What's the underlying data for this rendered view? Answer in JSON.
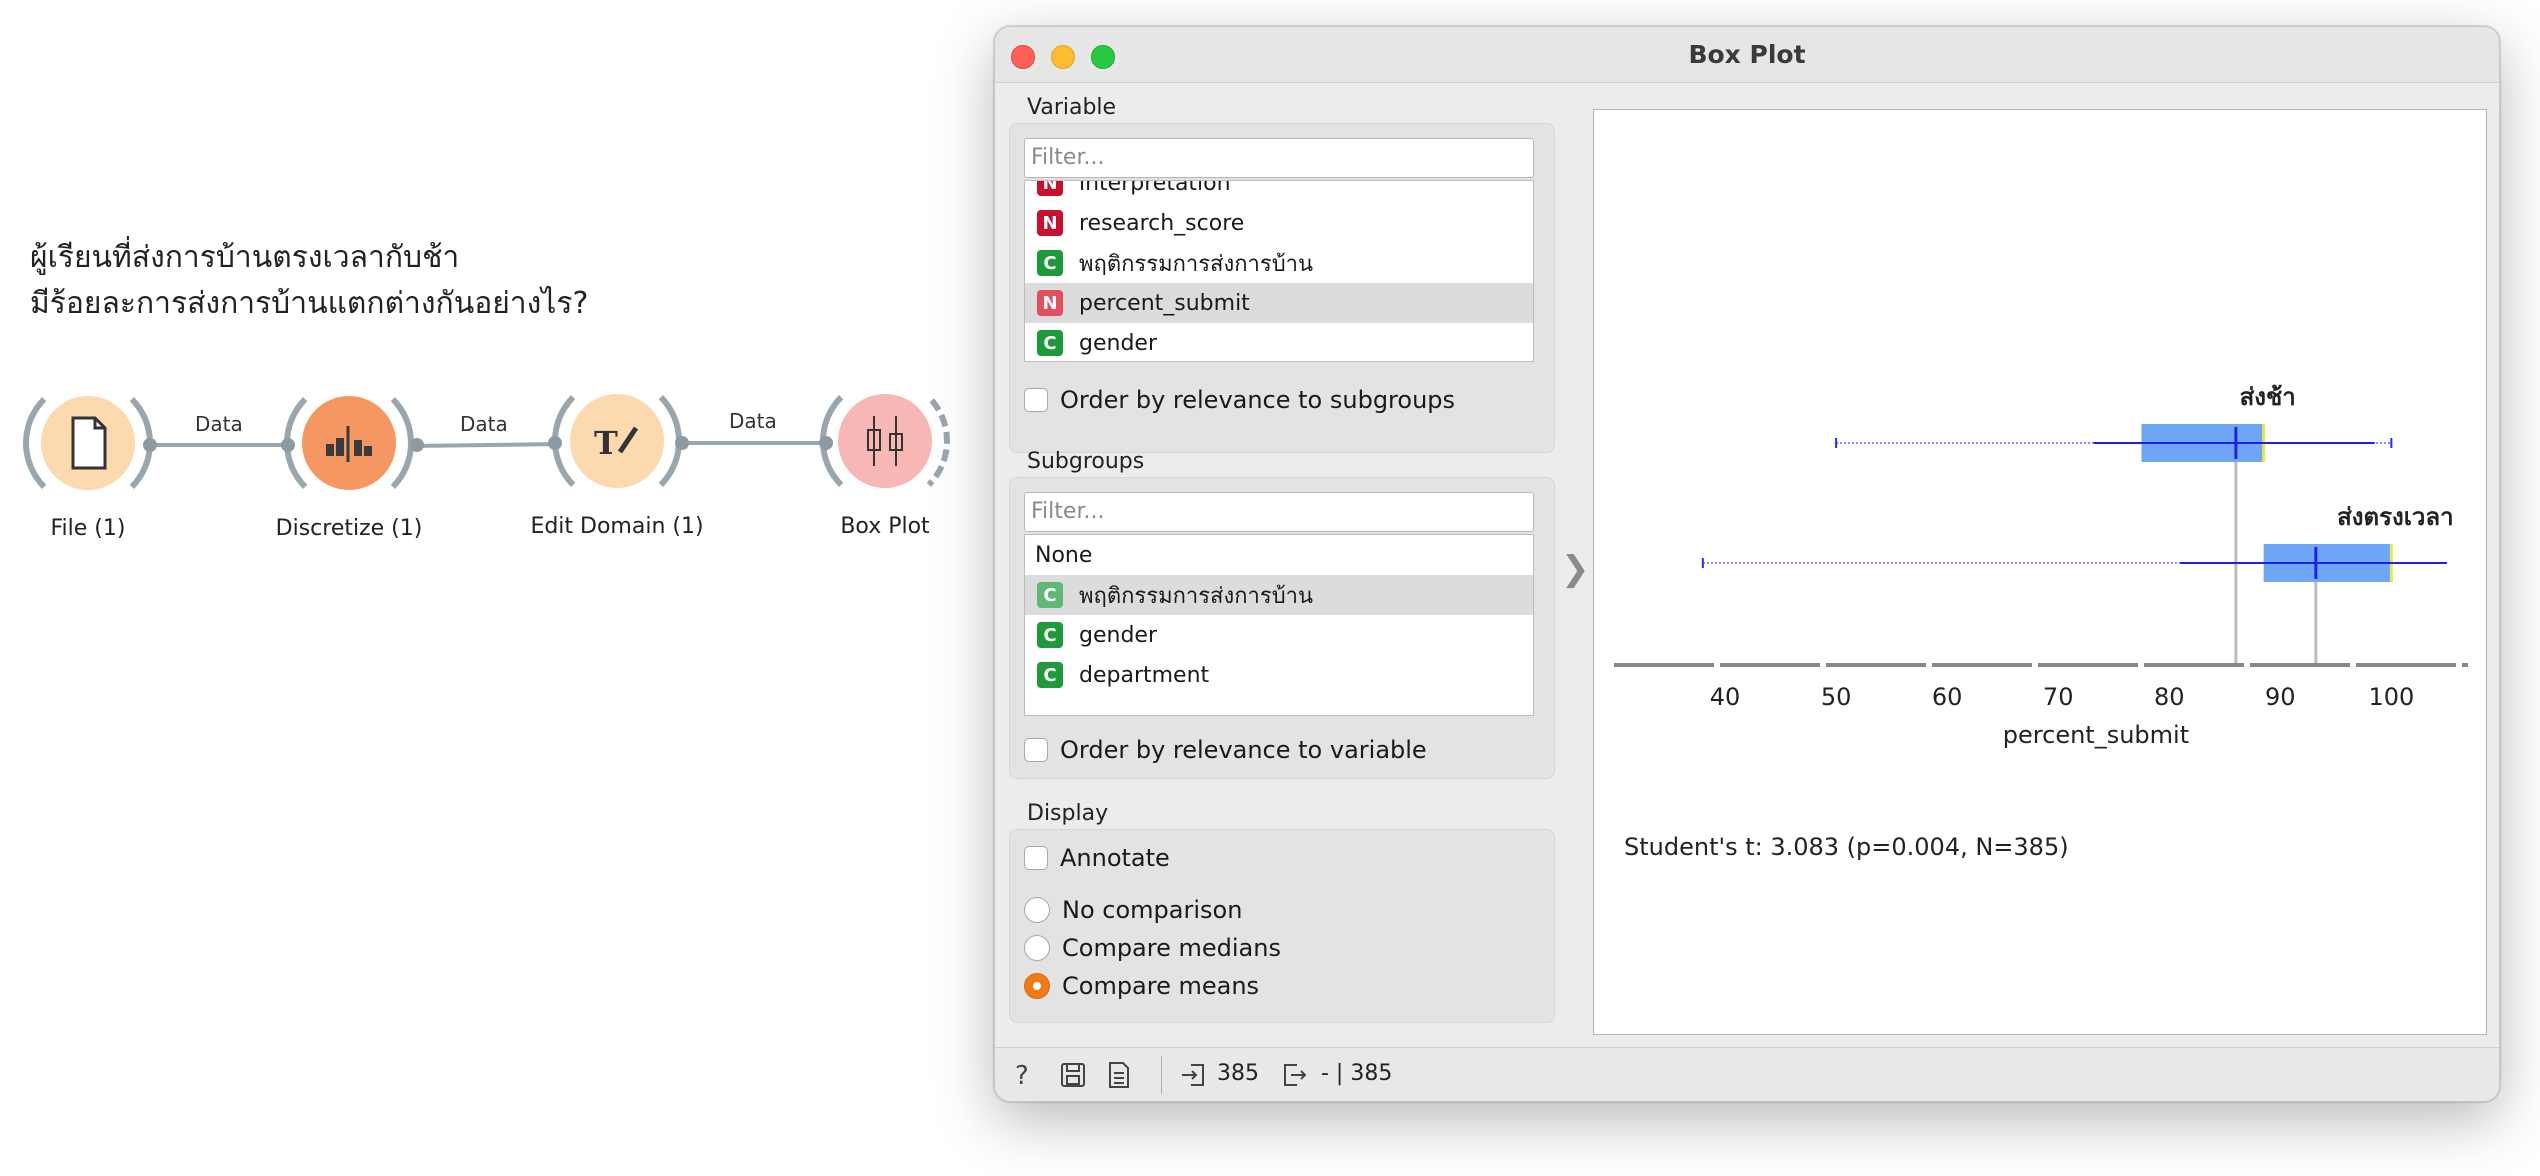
{
  "canvas": {
    "question_line1": "ผู้เรียนที่ส่งการบ้านตรงเวลากับช้า",
    "question_line2": "มีร้อยละการส่งการบ้านแตกต่างกันอย่างไร?",
    "nodes": [
      {
        "label": "File (1)",
        "icon": "file-icon"
      },
      {
        "label": "Discretize (1)",
        "icon": "discretize-icon"
      },
      {
        "label": "Edit Domain (1)",
        "icon": "edit-domain-icon"
      },
      {
        "label": "Box Plot",
        "icon": "box-plot-icon"
      }
    ],
    "links": [
      {
        "label": "Data"
      },
      {
        "label": "Data"
      },
      {
        "label": "Data"
      }
    ]
  },
  "window": {
    "title": "Box Plot",
    "variable": {
      "section_title": "Variable",
      "filter_placeholder": "Filter...",
      "items": [
        {
          "type": "N",
          "label": "interpretation",
          "selected": false
        },
        {
          "type": "N",
          "label": "research_score",
          "selected": false
        },
        {
          "type": "C",
          "label": "พฤติกรรมการส่งการบ้าน",
          "selected": false
        },
        {
          "type": "N",
          "label": "percent_submit",
          "selected": true
        },
        {
          "type": "C",
          "label": "gender",
          "selected": false
        }
      ],
      "order_label": "Order by relevance to subgroups"
    },
    "subgroups": {
      "section_title": "Subgroups",
      "filter_placeholder": "Filter...",
      "items": [
        {
          "type": "",
          "label": "None",
          "selected": false
        },
        {
          "type": "C",
          "label": "พฤติกรรมการส่งการบ้าน",
          "selected": true
        },
        {
          "type": "C",
          "label": "gender",
          "selected": false
        },
        {
          "type": "C",
          "label": "department",
          "selected": false
        }
      ],
      "order_label": "Order by relevance to variable"
    },
    "display": {
      "section_title": "Display",
      "annotate_label": "Annotate",
      "radios": [
        {
          "label": "No comparison",
          "checked": false
        },
        {
          "label": "Compare medians",
          "checked": false
        },
        {
          "label": "Compare means",
          "checked": true
        }
      ]
    },
    "statusbar": {
      "input_count": "385",
      "output_text": "- | 385"
    }
  },
  "chart_data": {
    "type": "boxplot",
    "orientation": "horizontal",
    "xlabel": "percent_submit",
    "xticks": [
      40,
      50,
      60,
      70,
      80,
      90,
      100
    ],
    "xlim": [
      30,
      106
    ],
    "box_color": "#6ea6f5",
    "series": [
      {
        "name": "ส่งช้า",
        "whisker_low": 50,
        "q1": 77.5,
        "median": 88.5,
        "q3": 88.5,
        "whisker_high": 100,
        "mean": 86,
        "sd_low": 73.2,
        "sd_high": 98.5
      },
      {
        "name": "ส่งตรงเวลา",
        "whisker_low": 38,
        "q1": 88.5,
        "median": 100,
        "q3": 100,
        "whisker_high": 100,
        "mean": 93.2,
        "sd_low": 81,
        "sd_high": 105
      }
    ],
    "stat_text": "Student's t: 3.083 (p=0.004, N=385)"
  }
}
